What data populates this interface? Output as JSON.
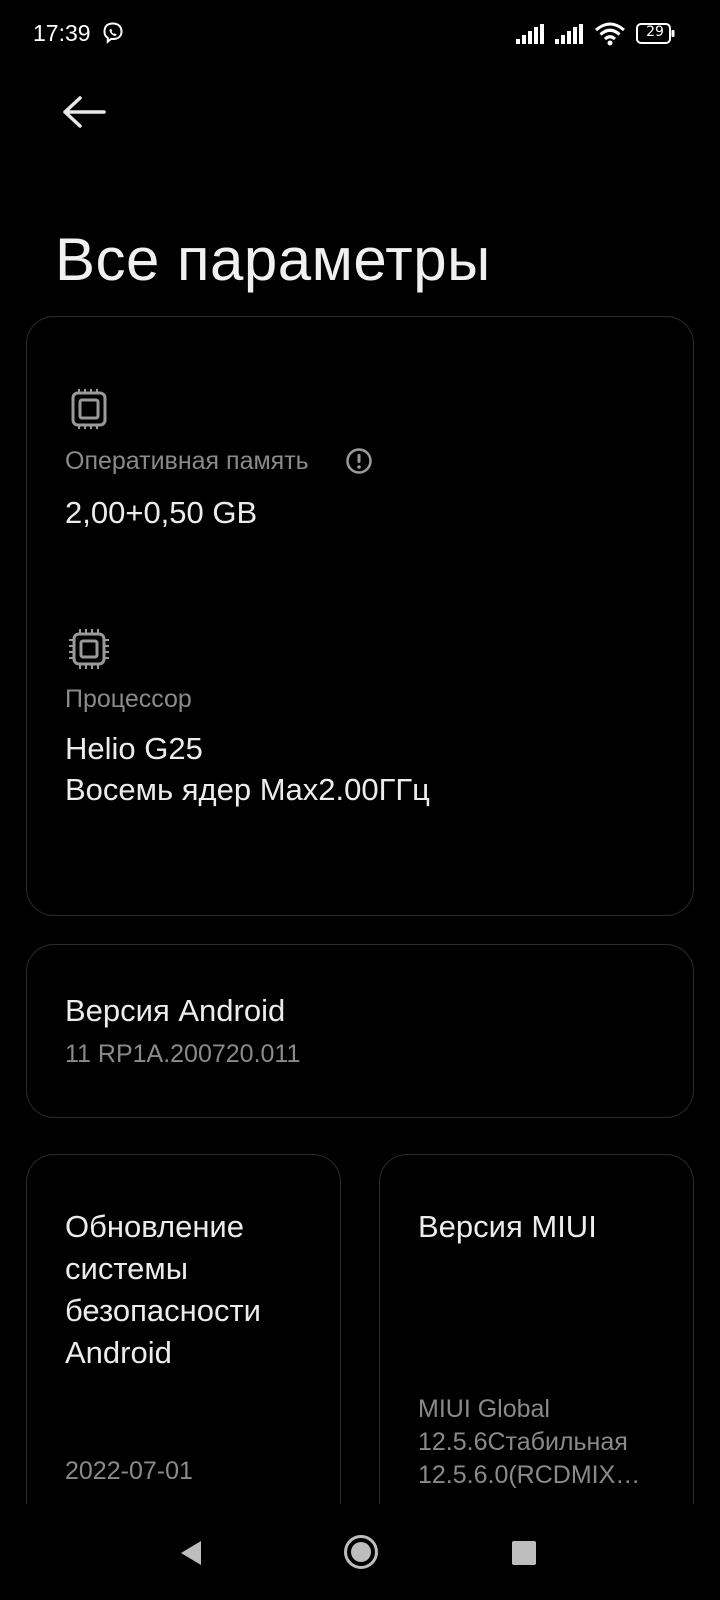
{
  "status_bar": {
    "time": "17:39",
    "battery": "29",
    "icons": [
      "viber-icon",
      "signal-icon",
      "signal-icon",
      "wifi-icon",
      "battery-icon"
    ]
  },
  "header": {
    "back_icon": "arrow-left-icon",
    "title": "Все параметры"
  },
  "specs_card": {
    "ram": {
      "icon": "ram-chip-icon",
      "label": "Оперативная память",
      "info_icon": "info-icon",
      "value": "2,00+0,50 GB"
    },
    "cpu": {
      "icon": "cpu-chip-icon",
      "label": "Процессор",
      "value_line1": "Helio G25",
      "value_line2": "Восемь ядер Max2.00ГГц"
    }
  },
  "android_version": {
    "title": "Версия Android",
    "value": "11 RP1A.200720.011"
  },
  "security_update": {
    "title_lines": [
      "Обновление",
      "системы",
      "безопасности",
      "Android"
    ],
    "value": "2022-07-01"
  },
  "miui_version": {
    "title": "Версия MIUI",
    "value_lines": [
      "MIUI Global",
      "12.5.6Стабильная",
      "12.5.6.0(RCDMIX…"
    ]
  },
  "nav_bar": {
    "icons": [
      "back-triangle-icon",
      "home-circle-icon",
      "recents-square-icon"
    ]
  }
}
